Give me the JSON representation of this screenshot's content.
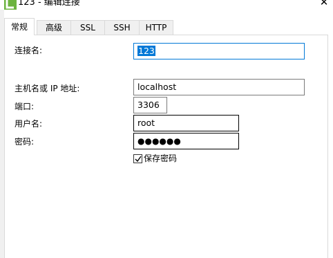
{
  "window": {
    "title": "123 - 编辑连接"
  },
  "tabs": [
    {
      "label": "常规"
    },
    {
      "label": "高级"
    },
    {
      "label": "SSL"
    },
    {
      "label": "SSH"
    },
    {
      "label": "HTTP"
    }
  ],
  "active_tab": "常规",
  "form": {
    "connection_name_label": "连接名:",
    "connection_name_value": "123",
    "host_label": "主机名或 IP 地址:",
    "host_value": "localhost",
    "port_label": "端口:",
    "port_value": "3306",
    "username_label": "用户名:",
    "username_value": "root",
    "password_label": "密码:",
    "password_value": "●●●●●●",
    "save_password_label": "保存密码",
    "save_password_checked": true
  },
  "icons": {
    "app": "navicat-icon",
    "close": "close-icon",
    "checkmark": "checkmark-icon"
  },
  "colors": {
    "accent": "#0078d7",
    "tab_bg": "#f0f0f0",
    "border": "#d9d9d9",
    "app_icon": "#6cb33f"
  }
}
